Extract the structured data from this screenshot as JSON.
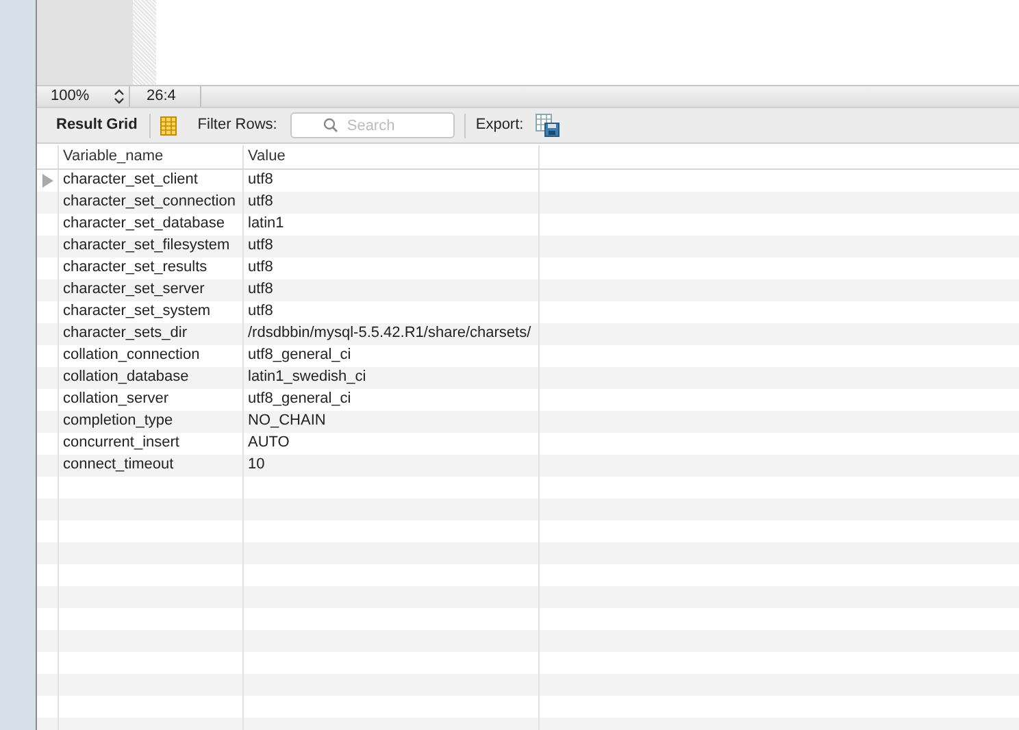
{
  "status_bar": {
    "zoom": "100%",
    "position": "26:4"
  },
  "toolbar": {
    "result_grid_label": "Result Grid",
    "filter_label": "Filter Rows:",
    "search_placeholder": "Search",
    "export_label": "Export:"
  },
  "table": {
    "columns": [
      "Variable_name",
      "Value"
    ],
    "rows": [
      {
        "cells": [
          "character_set_client",
          "utf8"
        ],
        "selected": true
      },
      {
        "cells": [
          "character_set_connection",
          "utf8"
        ],
        "selected": false
      },
      {
        "cells": [
          "character_set_database",
          "latin1"
        ],
        "selected": false
      },
      {
        "cells": [
          "character_set_filesystem",
          "utf8"
        ],
        "selected": false
      },
      {
        "cells": [
          "character_set_results",
          "utf8"
        ],
        "selected": false
      },
      {
        "cells": [
          "character_set_server",
          "utf8"
        ],
        "selected": false
      },
      {
        "cells": [
          "character_set_system",
          "utf8"
        ],
        "selected": false
      },
      {
        "cells": [
          "character_sets_dir",
          "/rdsdbbin/mysql-5.5.42.R1/share/charsets/"
        ],
        "selected": false
      },
      {
        "cells": [
          "collation_connection",
          "utf8_general_ci"
        ],
        "selected": false
      },
      {
        "cells": [
          "collation_database",
          "latin1_swedish_ci"
        ],
        "selected": false
      },
      {
        "cells": [
          "collation_server",
          "utf8_general_ci"
        ],
        "selected": false
      },
      {
        "cells": [
          "completion_type",
          "NO_CHAIN"
        ],
        "selected": false
      },
      {
        "cells": [
          "concurrent_insert",
          "AUTO"
        ],
        "selected": false
      },
      {
        "cells": [
          "connect_timeout",
          "10"
        ],
        "selected": false
      }
    ]
  }
}
